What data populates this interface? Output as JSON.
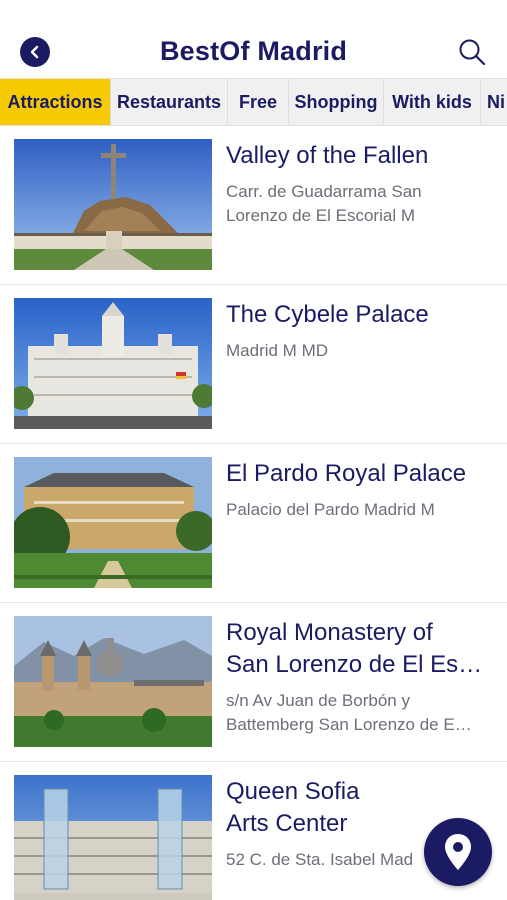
{
  "header": {
    "title": "BestOf Madrid"
  },
  "tabs": [
    "Attractions",
    "Restaurants",
    "Free",
    "Shopping",
    "With kids",
    "Ni"
  ],
  "places": [
    {
      "name_lines": [
        "Valley of the Fallen"
      ],
      "address_lines": [
        "Carr. de Guadarrama San",
        "Lorenzo de El Escorial M"
      ]
    },
    {
      "name_lines": [
        "The Cybele Palace"
      ],
      "address_lines": [
        "Madrid M MD"
      ]
    },
    {
      "name_lines": [
        "El Pardo Royal Palace"
      ],
      "address_lines": [
        "Palacio del Pardo Madrid M"
      ]
    },
    {
      "name_lines": [
        "Royal Monastery of",
        "San Lorenzo de El Es…"
      ],
      "address_lines": [
        "s/n Av Juan de Borbón y",
        "Battemberg San Lorenzo de E…"
      ]
    },
    {
      "name_lines": [
        "Queen Sofia",
        "Arts Center"
      ],
      "address_lines": [
        "52 C. de Sta. Isabel Mad"
      ]
    }
  ],
  "colors": {
    "primary": "#1b1b63",
    "accent": "#f7c900",
    "muted": "#6e6e78"
  },
  "icons": {
    "back": "chevron-left-icon",
    "search": "search-icon",
    "map": "map-pin-icon"
  }
}
